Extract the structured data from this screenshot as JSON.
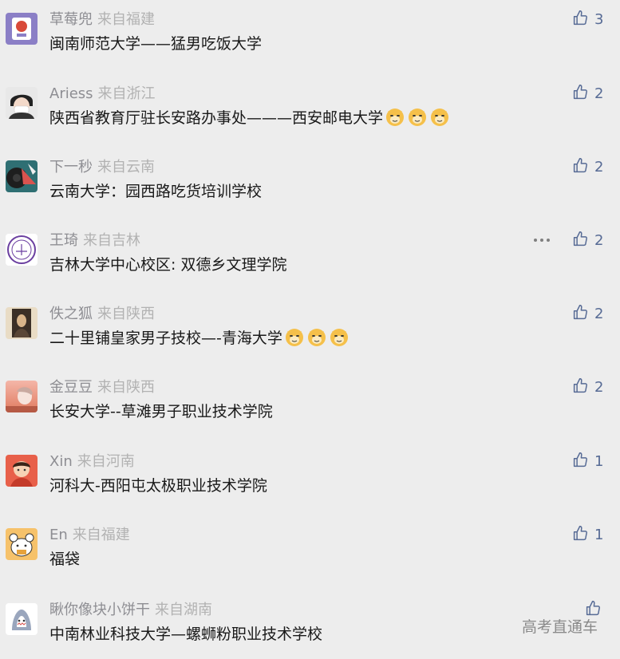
{
  "comments": [
    {
      "nickname": "草莓兜",
      "location": "来自福建",
      "content": "闽南师范大学——猛男吃饭大学",
      "likes": "3",
      "emoji_count": 0
    },
    {
      "nickname": "Ariess",
      "location": "来自浙江",
      "content": "陕西省教育厅驻长安路办事处———西安邮电大学",
      "likes": "2",
      "emoji_count": 3
    },
    {
      "nickname": "下一秒",
      "location": "来自云南",
      "content": "云南大学：园西路吃货培训学校",
      "likes": "2",
      "emoji_count": 0
    },
    {
      "nickname": "王琦",
      "location": "来自吉林",
      "content": "吉林大学中心校区: 双德乡文理学院",
      "likes": "2",
      "emoji_count": 0
    },
    {
      "nickname": "佚之狐",
      "location": "来自陕西",
      "content": "二十里铺皇家男子技校—-青海大学",
      "likes": "2",
      "emoji_count": 3
    },
    {
      "nickname": "金豆豆",
      "location": "来自陕西",
      "content": "长安大学--草滩男子职业技术学院",
      "likes": "2",
      "emoji_count": 0
    },
    {
      "nickname": "Xin",
      "location": "来自河南",
      "content": "河科大-西阳屯太极职业技术学院",
      "likes": "1",
      "emoji_count": 0
    },
    {
      "nickname": "En",
      "location": "来自福建",
      "content": "福袋",
      "likes": "1",
      "emoji_count": 0
    },
    {
      "nickname": "瞅你像块小饼干",
      "location": "来自湖南",
      "content": "中南林业科技大学—螺蛳粉职业技术学校",
      "likes": "",
      "emoji_count": 0
    }
  ],
  "watermark": "高考直通车",
  "colors": {
    "background": "#ededed",
    "nickname": "#8e8e93",
    "location": "#b2b2b2",
    "content": "#191919",
    "like": "#576b95"
  },
  "icons": {
    "like": "thumbs-up-icon",
    "more": "more-dots-icon",
    "emoji": "doge-emoji-icon"
  }
}
